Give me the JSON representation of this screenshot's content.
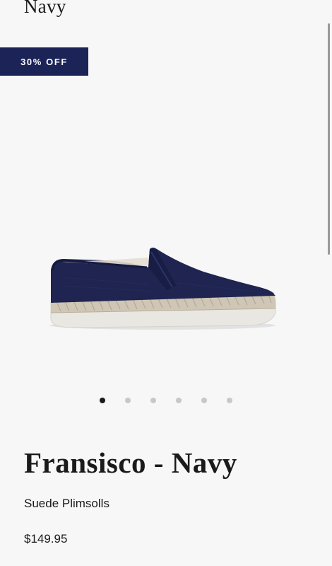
{
  "header": {
    "title": "Navy"
  },
  "badge": {
    "label": "30% OFF",
    "color": "#1b2357"
  },
  "gallery": {
    "image": "navy-suede-slip-on-shoe-image",
    "slide_count": 6,
    "active_index": 0
  },
  "product": {
    "name": "Fransisco - Navy",
    "subtitle": "Suede Plimsolls",
    "price": "$149.95"
  }
}
